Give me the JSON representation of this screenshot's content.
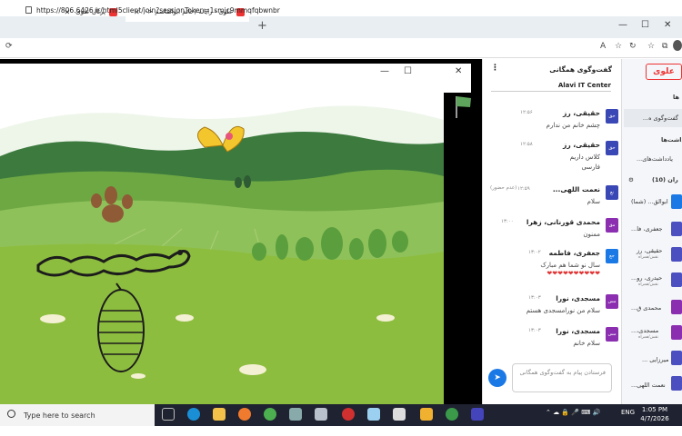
{
  "browser": {
    "tabs": [
      {
        "label": "پرتال علوی",
        "active": false
      },
      {
        "label": "علوی - رایانه (خانم ابوالقاسم <-",
        "active": true
      }
    ],
    "new_tab": "+",
    "url": "https://806.6426.ir/html5client/join?sessionToken=1smjc9mmqfqbwnbr",
    "window_controls": {
      "minimize": "—",
      "maximize": "☐",
      "close": "✕"
    }
  },
  "meeting_popup": {
    "minimize": "—",
    "maximize": "☐",
    "close": "✕"
  },
  "chat": {
    "title": "گفت‌وگوی همگانی",
    "center_name": "Alavi IT Center",
    "messages": [
      {
        "initials": "حق",
        "name": "حقیقی، رز",
        "time": "۱۲:۵۶",
        "lines": [
          "چشم خانم من ندارم"
        ],
        "color": "#3a48b6"
      },
      {
        "initials": "حق",
        "name": "حقیقی، رز",
        "time": "۱۲:۵۸",
        "lines": [
          "کلاس داریم",
          "فارسی"
        ],
        "color": "#3a48b6"
      },
      {
        "initials": "نع",
        "name": "نعمت اللهی...",
        "time": "۱۲:۵۹",
        "status": "(عدم حضور)",
        "lines": [
          "سلام"
        ],
        "color": "#3a48b6"
      },
      {
        "initials": "مق",
        "name": "محمدی قورنانی، زهرا",
        "time": "۱۳:۰۰",
        "lines": [
          "ممنون"
        ],
        "color": "#8b2fb0"
      },
      {
        "initials": "جع",
        "name": "جعفری، فاطمه",
        "time": "۱۳:۰۲",
        "lines": [
          "سال نو شما هم مبارک"
        ],
        "hearts": "❤❤❤❤❤❤❤❤❤❤",
        "color": "#1b79e6"
      },
      {
        "initials": "مس",
        "name": "مسجدی، نورا",
        "time": "۱۳:۰۳",
        "lines": [
          "سلام من نورامسجدی هستم"
        ],
        "color": "#8b2fb0"
      },
      {
        "initials": "مس",
        "name": "مسجدی، نورا",
        "time": "۱۳:۰۳",
        "lines": [
          "سلام خانم"
        ],
        "color": "#8b2fb0"
      }
    ],
    "input_placeholder": "فرستادن پیام به گفت‌وگوی همگانی",
    "send_icon": "send-icon"
  },
  "sidebar": {
    "logo": "علوی",
    "section_messages": "ها",
    "public_chat": "گفت‌وگوی ه...",
    "section_notes": "داشت‌ها",
    "shared_notes": "یادداشت‌های...",
    "section_users": "ران (10)",
    "users": [
      {
        "name": "ابوالق... (شما)",
        "sub": ""
      },
      {
        "name": "جعفری، فا...",
        "sub": ""
      },
      {
        "name": "حقیقی، رز",
        "sub": "نقش/همراه"
      },
      {
        "name": "حیدری، رو...",
        "sub": "نقش/همراه"
      },
      {
        "name": "محمدی ق...",
        "sub": ""
      },
      {
        "name": "مسجدی،...",
        "sub": "نقش/همراه"
      },
      {
        "name": "میرزایی ...",
        "sub": ""
      },
      {
        "name": "نعمت اللهی...",
        "sub": ""
      }
    ]
  },
  "taskbar": {
    "search_placeholder": "Type here to search",
    "language": "ENG",
    "time": "1:05 PM",
    "date": "4/7/2026"
  }
}
